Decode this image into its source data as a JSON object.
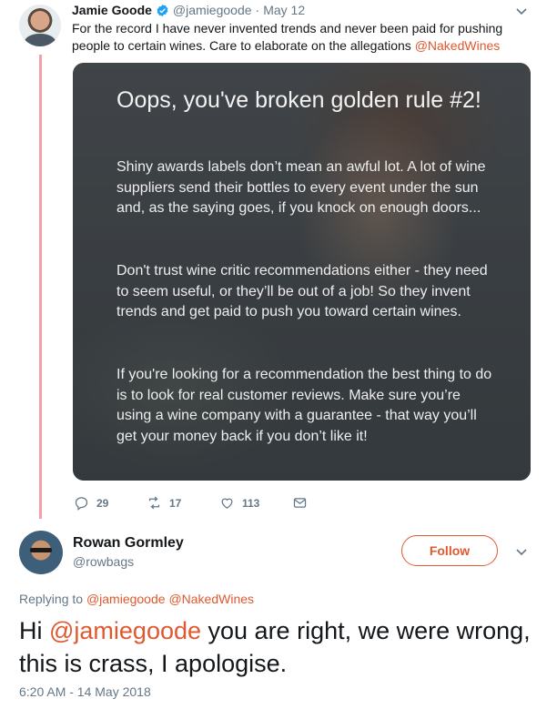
{
  "colors": {
    "accent": "#e0582e",
    "thread_line": "#f5a0a9",
    "muted": "#657786",
    "verified": "#1da1f2"
  },
  "tweet1": {
    "name": "Jamie Goode",
    "handle": "@jamiegoode",
    "dot": "·",
    "date": "May 12",
    "text_before": "For the record I have never invented trends and never been paid for pushing people to certain wines. Care to elaborate on the allegations ",
    "text_mention": "@NakedWines",
    "media": {
      "title": "Oops, you've broken golden rule #2!",
      "para1": "Shiny awards labels don’t mean an awful lot. A lot of wine suppliers send their bottles to every event under the sun and, as the saying goes, if you knock on enough doors...",
      "para2": "Don't trust wine critic recommendations either - they need to seem useful, or they’ll be out of a job! So they invent trends and get paid to push you toward certain wines.",
      "para3": "If you're looking for a recommendation the best thing to do is to look for real customer reviews. Make sure you’re using a wine company with a guarantee - that way you’ll get your money back if you don’t like it!"
    },
    "actions": {
      "replies": "29",
      "retweets": "17",
      "likes": "113"
    }
  },
  "tweet2": {
    "name": "Rowan Gormley",
    "handle": "@rowbags",
    "follow_label": "Follow",
    "replying_prefix": "Replying to",
    "replying_mention1": "@jamiegoode",
    "replying_mention2": "@NakedWines",
    "text_prefix": "Hi ",
    "text_mention": "@jamiegoode",
    "text_rest": " you are right, we were wrong, this is crass, I apologise.",
    "timestamp": "6:20 AM - 14 May 2018"
  }
}
